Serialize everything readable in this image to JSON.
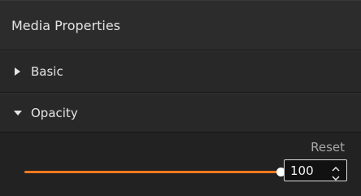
{
  "panel": {
    "title": "Media Properties"
  },
  "sections": {
    "basic": {
      "label": "Basic",
      "expanded": false,
      "icon": "triangle-right-icon"
    },
    "opacity": {
      "label": "Opacity",
      "expanded": true,
      "icon": "triangle-down-icon",
      "reset_label": "Reset",
      "value": "100",
      "slider_fraction": 1.0
    }
  },
  "colors": {
    "accent": "#f07a1c",
    "panel_bg": "#1c1c1c",
    "header_bg": "#2c2c2c",
    "text": "#e4e4e4"
  }
}
